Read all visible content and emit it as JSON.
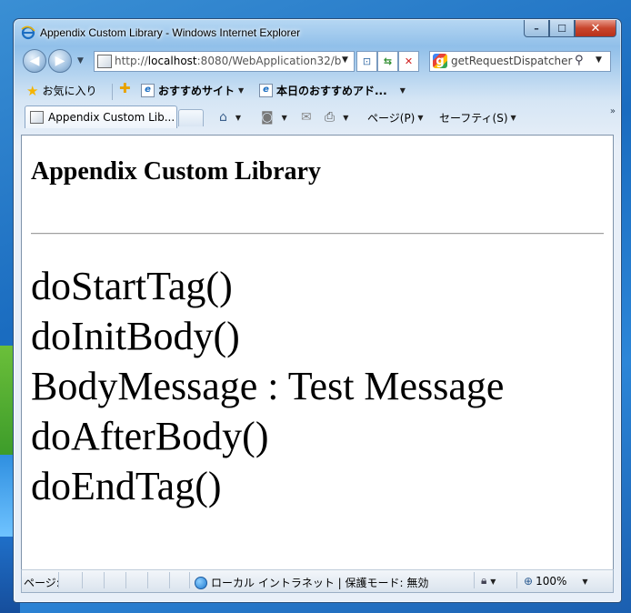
{
  "window": {
    "title": "Appendix Custom Library - Windows Internet Explorer",
    "minimize": "–",
    "maximize": "☐",
    "close": "✕"
  },
  "address": {
    "url_prefix": "http://",
    "url_host": "localhost",
    "url_rest": ":8080/WebApplication32/b",
    "search_value": "getRequestDispatcher"
  },
  "favorites": {
    "favorites_label": "お気に入り",
    "suggested_sites": "おすすめサイト",
    "todays_addon": "本日のおすすめアド..."
  },
  "tabs": [
    {
      "label": "Appendix Custom Lib..."
    }
  ],
  "toolbar": {
    "page": "ページ(P)",
    "safety": "セーフティ(S)"
  },
  "page": {
    "heading": "Appendix Custom Library",
    "lines": [
      "doStartTag()",
      "doInitBody()",
      "BodyMessage : Test Message",
      "doAfterBody()",
      "doEndTag()"
    ]
  },
  "status": {
    "text": "ページ:",
    "zone": "ローカル イントラネット | 保護モード: 無効",
    "zoom": "100%"
  },
  "colors": {
    "accent": "#1b6ec2",
    "close_button": "#c8452c"
  }
}
